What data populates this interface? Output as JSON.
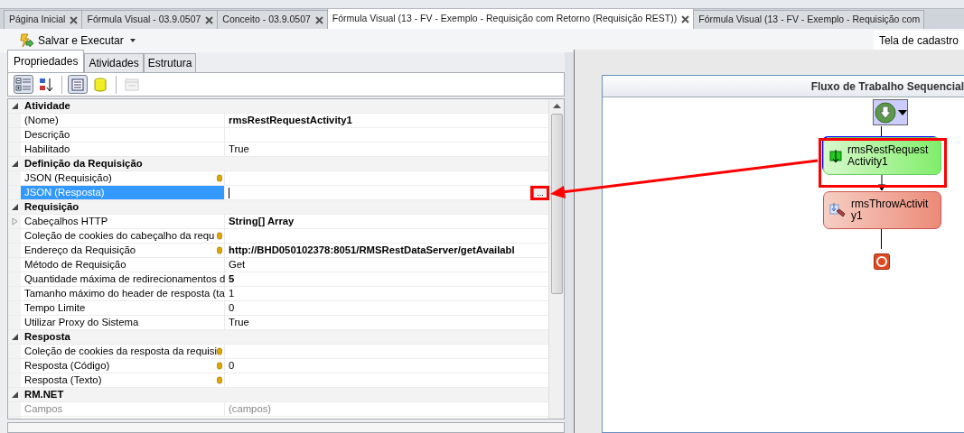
{
  "tabs": [
    {
      "label": "Página Inicial",
      "selected": false,
      "closable": true
    },
    {
      "label": "Fórmula Visual - 03.9.0507",
      "selected": false,
      "closable": true
    },
    {
      "label": "Conceito - 03.9.0507",
      "selected": false,
      "closable": true
    },
    {
      "label": "Fórmula Visual (13 - FV - Exemplo - Requisição com Retorno (Requisição REST))",
      "selected": true,
      "closable": true
    },
    {
      "label": "Fórmula Visual (13 - FV - Exemplo - Requisição com",
      "selected": false,
      "closable": false
    }
  ],
  "toolbar": {
    "save_button": "Salvar e Executar",
    "status_text": "Tela de cadastro"
  },
  "panel_tabs": [
    {
      "label": "Propriedades",
      "selected": true
    },
    {
      "label": "Atividades",
      "selected": false
    },
    {
      "label": "Estrutura",
      "selected": false
    }
  ],
  "grid_toolbar": [
    {
      "kind": "categorized",
      "pressed": true,
      "disabled": false
    },
    {
      "kind": "alphabetical",
      "pressed": false,
      "disabled": false
    },
    {
      "kind": "properties",
      "pressed": true,
      "disabled": false
    },
    {
      "kind": "database",
      "pressed": false,
      "disabled": false
    },
    {
      "kind": "pages",
      "pressed": false,
      "disabled": true
    }
  ],
  "property_grid": {
    "categories": [
      {
        "name": "Atividade",
        "expanded": true,
        "properties": [
          {
            "name": "(Nome)",
            "value": "rmsRestRequestActivity1",
            "bold": true,
            "bound": false,
            "selected": false,
            "disabled": false,
            "expandable": false
          },
          {
            "name": "Descrição",
            "bold": false,
            "bound": false,
            "selected": false,
            "disabled": false,
            "expandable": false
          },
          {
            "name": "Habilitado",
            "value": "True",
            "bold": false,
            "bound": false,
            "selected": false,
            "disabled": false,
            "expandable": false
          }
        ]
      },
      {
        "name": "Definição da Requisição",
        "expanded": true,
        "properties": [
          {
            "name": "JSON (Requisição)",
            "bold": false,
            "bound": true,
            "selected": false,
            "disabled": false,
            "expandable": false
          },
          {
            "name": "JSON (Resposta)",
            "bold": false,
            "bound": false,
            "selected": true,
            "disabled": false,
            "expandable": false,
            "editor_button": "..."
          }
        ]
      },
      {
        "name": "Requisição",
        "expanded": true,
        "properties": [
          {
            "name": "Cabeçalhos HTTP",
            "value": "String[] Array",
            "bold": true,
            "bound": false,
            "selected": false,
            "disabled": false,
            "expandable": true
          },
          {
            "name": "Coleção de cookies do cabeçalho da requ",
            "bold": false,
            "bound": true,
            "selected": false,
            "disabled": false,
            "expandable": false
          },
          {
            "name": "Endereço da Requisição",
            "value": "http://BHD050102378:8051/RMSRestDataServer/getAvailabl",
            "bold": true,
            "bound": true,
            "selected": false,
            "disabled": false,
            "expandable": false
          },
          {
            "name": "Método de Requisição",
            "value": "Get",
            "bold": false,
            "bound": false,
            "selected": false,
            "disabled": false,
            "expandable": false
          },
          {
            "name": "Quantidade máxima de redirecionamentos d",
            "value": "5",
            "bold": true,
            "bound": false,
            "selected": false,
            "disabled": false,
            "expandable": false
          },
          {
            "name": "Tamanho máximo do header de resposta (ta",
            "value": "1",
            "bold": false,
            "bound": false,
            "selected": false,
            "disabled": false,
            "expandable": false
          },
          {
            "name": "Tempo Limite",
            "value": "0",
            "bold": false,
            "bound": false,
            "selected": false,
            "disabled": false,
            "expandable": false
          },
          {
            "name": "Utilizar Proxy do Sistema",
            "value": "True",
            "bold": false,
            "bound": false,
            "selected": false,
            "disabled": false,
            "expandable": false
          }
        ]
      },
      {
        "name": "Resposta",
        "expanded": true,
        "properties": [
          {
            "name": "Coleção de cookies da resposta da requisi",
            "bold": false,
            "bound": true,
            "selected": false,
            "disabled": false,
            "expandable": false
          },
          {
            "name": "Resposta (Código)",
            "value": "0",
            "bold": false,
            "bound": true,
            "selected": false,
            "disabled": false,
            "expandable": false
          },
          {
            "name": "Resposta (Texto)",
            "bold": false,
            "bound": true,
            "selected": false,
            "disabled": false,
            "expandable": false
          }
        ]
      },
      {
        "name": "RM.NET",
        "expanded": true,
        "properties": [
          {
            "name": "Campos",
            "value": "(campos)",
            "bold": false,
            "bound": false,
            "selected": false,
            "disabled": true,
            "expandable": false
          }
        ]
      }
    ]
  },
  "designer": {
    "title": "Fluxo de Trabalho Sequencial",
    "activities": [
      {
        "label": "rmsRestRequestActivity1",
        "kind": "rest",
        "selected": true
      },
      {
        "label": "rmsThrowActivity1",
        "kind": "throw",
        "selected": false
      }
    ]
  }
}
